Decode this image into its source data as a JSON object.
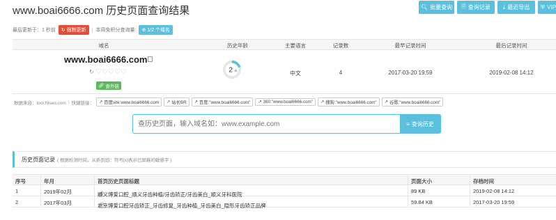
{
  "header": {
    "title": "www.boai6666.com 历史页面查询结果",
    "buttons": [
      {
        "label": "批量查询",
        "icon": "search-icon"
      },
      {
        "label": "查询记录",
        "icon": "document-icon"
      },
      {
        "label": "最近导出",
        "icon": "download-icon"
      },
      {
        "label": "VIP",
        "icon": "shield-icon"
      }
    ]
  },
  "meta": {
    "updated": "最后更新于：1 秒前",
    "force_update": "强制更新",
    "points_label": "本周免积分查询量:",
    "points_value": "1/2 个域名"
  },
  "domain_table": {
    "headers": [
      "域名",
      "历史年龄",
      "主要语言",
      "记录数",
      "最早记录时间",
      "最后记录时间"
    ],
    "domain": "www.boai6666.com",
    "hearts": "♡♡♡♡♡",
    "ext_link": "查外链",
    "age": "2",
    "age_unit": "年",
    "age_fraction": 0.2,
    "language": "中文",
    "record_count": "4",
    "earliest": "2017-03-20 19:59",
    "latest": "2019-02-08 14:12"
  },
  "sources": {
    "data_source": "数据来自：tool.f9seo.com",
    "quick_links_label": "快捷链接：",
    "links": [
      "百度site:www.boai6666.com",
      "站长BR",
      "百度:\"www.boai6666.com\"",
      "360:\"www.boai6666.com\"",
      "搜狗:\"www.boai6666.com\"",
      "谷歌:\"www.boai6666.com\""
    ]
  },
  "search": {
    "placeholder": "查历史页面，输入域名如：www.example.com",
    "button": "查询历史"
  },
  "history": {
    "title": "历史页面记录",
    "subtitle": "( 根据检测时间，从新到旧：符号[x]表示已屏蔽的敏感字 )",
    "headers": [
      "序号",
      "年月",
      "首页历史页面标题",
      "页面大小",
      "存档时间"
    ],
    "rows": [
      {
        "index": "1",
        "month": "2019年02月",
        "title": "顺义博爱口腔_顺义牙齿种植/牙齿矫正/牙齿美白_顺义牙科医院",
        "size": "89 KB",
        "time": "2019-02-08 14:12"
      },
      {
        "index": "2",
        "month": "2017年03月",
        "title": "北京博爱口腔牙齿矫正_牙齿修复_牙齿种植_牙齿美白_隐形牙齿矫正品牌",
        "size": "59.84 KB",
        "time": "2017-03-20 19:59"
      }
    ]
  },
  "colors": {
    "accent": "#5bc0de",
    "danger": "#e04e39",
    "success": "#5cb85c"
  }
}
